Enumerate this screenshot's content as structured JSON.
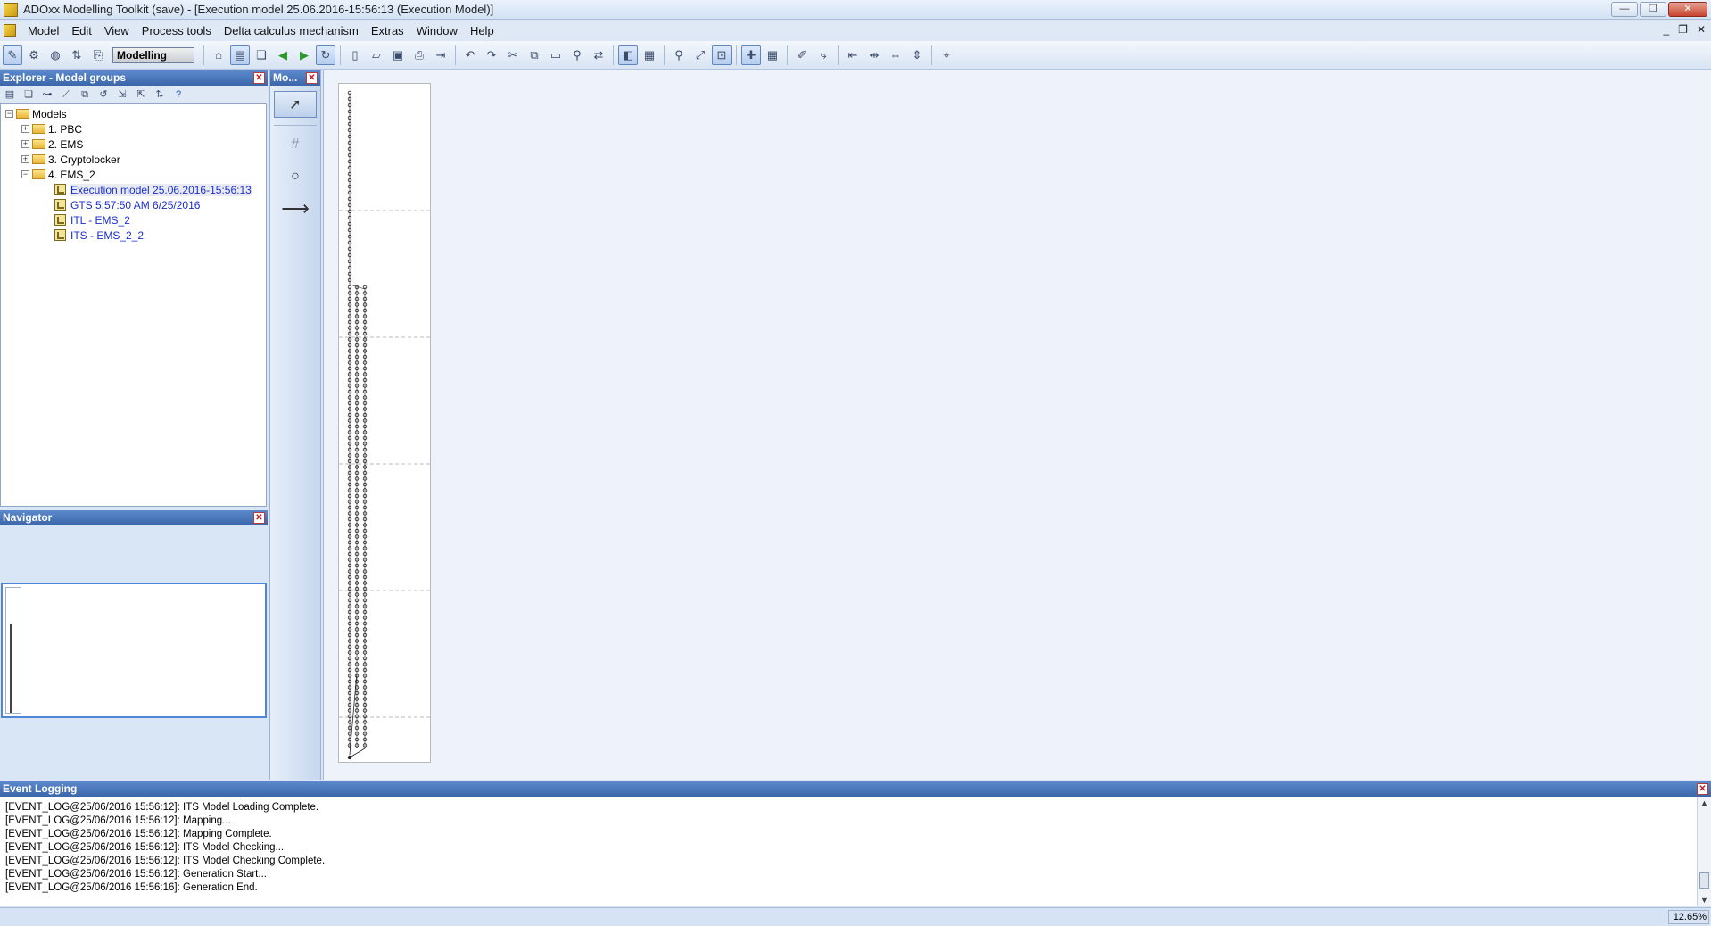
{
  "window": {
    "title": "ADOxx Modelling Toolkit (save) - [Execution model 25.06.2016-15:56:13 (Execution Model)]",
    "controls": [
      "—",
      "❐",
      "✕"
    ],
    "mdi_controls": [
      "_",
      "❐",
      "✕"
    ]
  },
  "menubar": {
    "items": [
      "Model",
      "Edit",
      "View",
      "Process tools",
      "Delta calculus mechanism",
      "Extras",
      "Window",
      "Help"
    ]
  },
  "toolbar": {
    "mode_label": "Modelling"
  },
  "explorer": {
    "title": "Explorer - Model groups",
    "tree": {
      "root": "Models",
      "groups": [
        {
          "label": "1. PBC",
          "expanded": false
        },
        {
          "label": "2. EMS",
          "expanded": false
        },
        {
          "label": "3. Cryptolocker",
          "expanded": false
        },
        {
          "label": "4. EMS_2",
          "expanded": true
        }
      ],
      "models": [
        {
          "label": "Execution model 25.06.2016-15:56:13",
          "selected": true
        },
        {
          "label": "GTS 5:57:50 AM 6/25/2016",
          "selected": false
        },
        {
          "label": "ITL - EMS_2",
          "selected": false
        },
        {
          "label": "ITS - EMS_2_2",
          "selected": false
        }
      ]
    }
  },
  "palette": {
    "title": "Mo..."
  },
  "navigator": {
    "title": "Navigator"
  },
  "event_log": {
    "title": "Event Logging",
    "lines": [
      "[EVENT_LOG@25/06/2016 15:56:12]: ITS Model Loading Complete.",
      "[EVENT_LOG@25/06/2016 15:56:12]: Mapping...",
      "[EVENT_LOG@25/06/2016 15:56:12]: Mapping Complete.",
      "[EVENT_LOG@25/06/2016 15:56:12]: ITS Model Checking...",
      "[EVENT_LOG@25/06/2016 15:56:12]: ITS Model Checking Complete.",
      "[EVENT_LOG@25/06/2016 15:56:12]: Generation Start...",
      "[EVENT_LOG@25/06/2016 15:56:16]: Generation End."
    ]
  },
  "status": {
    "zoom": "12.65%"
  }
}
